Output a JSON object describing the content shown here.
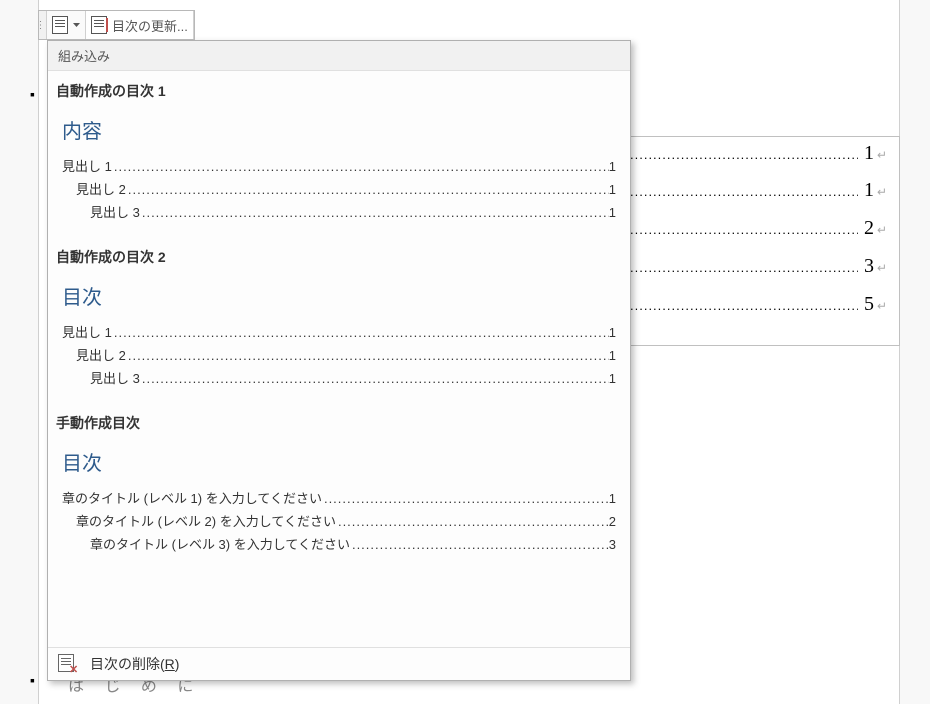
{
  "toolbar": {
    "update_toc_label": "目次の更新..."
  },
  "document_visible_entries": [
    {
      "page": "1"
    },
    {
      "page": "1"
    },
    {
      "page": "2"
    },
    {
      "page": "3"
    },
    {
      "page": "5"
    }
  ],
  "background_text": "は じ め に",
  "popup": {
    "header": "組み込み",
    "styles": [
      {
        "title": "自動作成の目次 1",
        "preview_heading": "内容",
        "entries": [
          {
            "level": 1,
            "text": "見出し 1",
            "page": "1"
          },
          {
            "level": 2,
            "text": "見出し 2",
            "page": "1"
          },
          {
            "level": 3,
            "text": "見出し 3",
            "page": "1"
          }
        ]
      },
      {
        "title": "自動作成の目次 2",
        "preview_heading": "目次",
        "entries": [
          {
            "level": 1,
            "text": "見出し 1",
            "page": "1"
          },
          {
            "level": 2,
            "text": "見出し 2",
            "page": "1"
          },
          {
            "level": 3,
            "text": "見出し 3",
            "page": "1"
          }
        ]
      },
      {
        "title": "手動作成目次",
        "preview_heading": "目次",
        "entries": [
          {
            "level": 1,
            "text": "章のタイトル (レベル 1) を入力してください",
            "page": "1"
          },
          {
            "level": 2,
            "text": "章のタイトル (レベル 2) を入力してください",
            "page": "2"
          },
          {
            "level": 3,
            "text": "章のタイトル (レベル 3) を入力してください",
            "page": "3"
          }
        ]
      }
    ],
    "footer": {
      "label_pre": "目次の削除(",
      "label_key": "R",
      "label_post": ")"
    }
  }
}
